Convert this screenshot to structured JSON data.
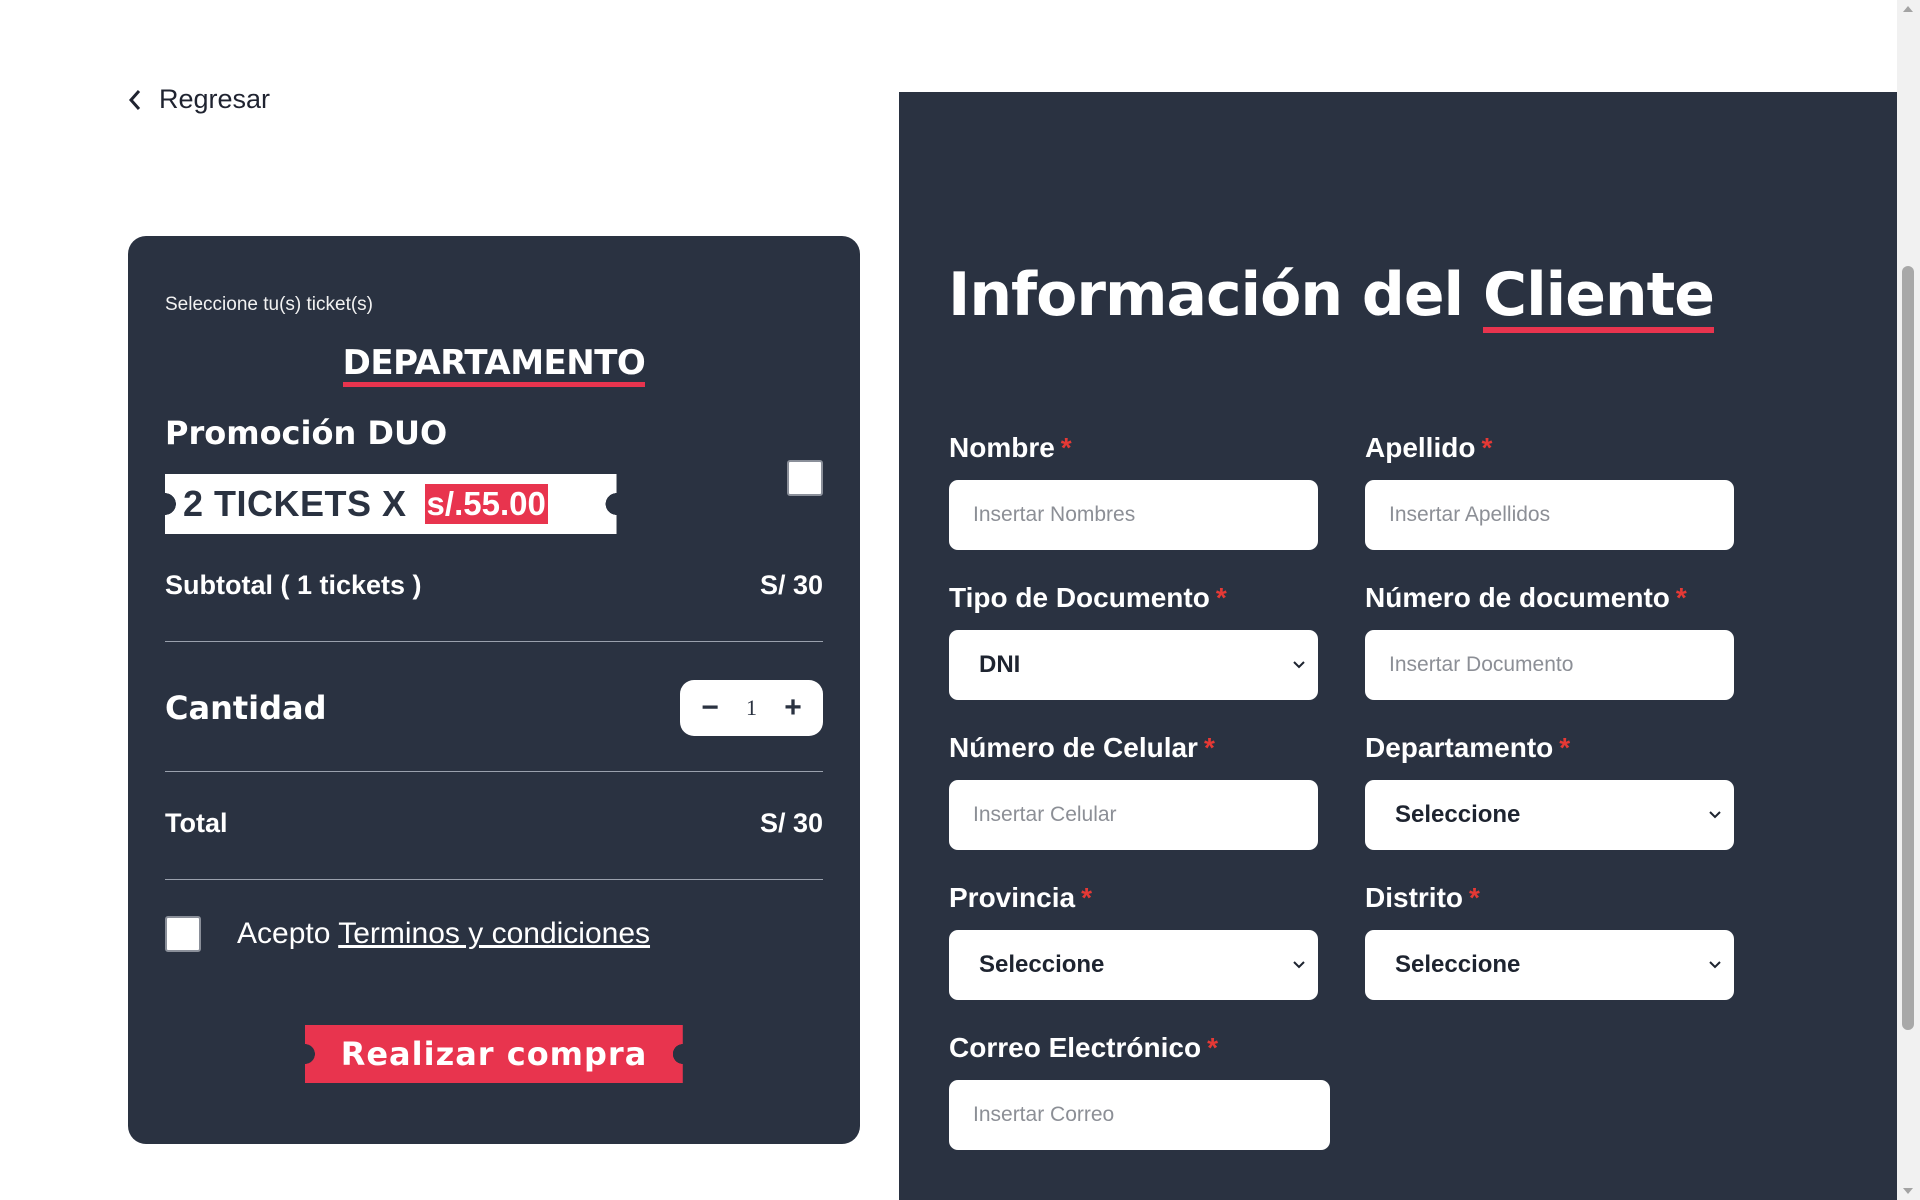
{
  "back": {
    "label": "Regresar"
  },
  "cart": {
    "hint": "Seleccione tu(s) ticket(s)",
    "section_title": "DEPARTAMENTO",
    "promo": {
      "title": "Promoción DUO",
      "ticket_text": "2 TICKETS X",
      "price": "s/.55.00"
    },
    "subtotal": {
      "label": "Subtotal ( 1 tickets )",
      "value": "S/ 30"
    },
    "quantity": {
      "label": "Cantidad",
      "minus": "−",
      "value": "1",
      "plus": "+"
    },
    "total": {
      "label": "Total",
      "value": "S/ 30"
    },
    "terms": {
      "prefix": "Acepto",
      "link": "Terminos y condiciones"
    },
    "buy_label": "Realizar compra"
  },
  "form": {
    "title_main": "Información del",
    "title_highlight": "Cliente",
    "required_mark": "*",
    "fields": {
      "nombre": {
        "label": "Nombre",
        "placeholder": "Insertar Nombres"
      },
      "apellido": {
        "label": "Apellido",
        "placeholder": "Insertar Apellidos"
      },
      "tipo_documento": {
        "label": "Tipo de Documento",
        "value": "DNI"
      },
      "numero_documento": {
        "label": "Número de documento",
        "placeholder": "Insertar Documento"
      },
      "celular": {
        "label": "Número de Celular",
        "placeholder": "Insertar Celular"
      },
      "departamento": {
        "label": "Departamento",
        "value": "Seleccione"
      },
      "provincia": {
        "label": "Provincia",
        "value": "Seleccione"
      },
      "distrito": {
        "label": "Distrito",
        "value": "Seleccione"
      },
      "correo": {
        "label": "Correo Electrónico",
        "placeholder": "Insertar Correo"
      }
    }
  },
  "colors": {
    "panel": "#2a3241",
    "accent": "#e8344e",
    "required": "#e53935"
  },
  "icons": {
    "back": "chevron-left-icon",
    "select_arrow": "chevron-down-icon"
  }
}
